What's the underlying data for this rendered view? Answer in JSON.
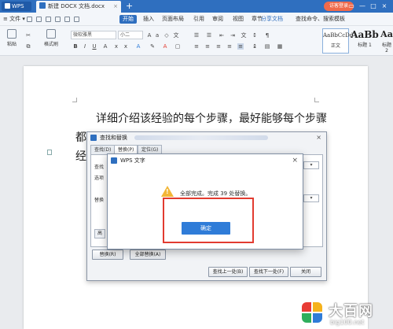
{
  "titlebar": {
    "app_button": "WPS",
    "doc_tab": "新建 DOCX 文档.docx",
    "tab_close": "×",
    "new_tab": "+",
    "login": "访客登录",
    "controls": [
      "▭",
      "—",
      "□",
      "×"
    ]
  },
  "menubar": {
    "file": "≡ 文件 ▾",
    "items": [
      "开始",
      "插入",
      "页面布局",
      "引用",
      "审阅",
      "视图",
      "章节"
    ],
    "share": "分享文档",
    "search": "查找命令、搜索模板"
  },
  "ribbon": {
    "paste": "粘贴",
    "format_painter": "格式刷",
    "font_name": "微软雅黑",
    "font_size": "小二",
    "styles": [
      {
        "sample": "AaBbCcDd",
        "name": "正文"
      },
      {
        "sample": "AaBb",
        "name": "标题 1"
      },
      {
        "sample": "Aa",
        "name": "标题 2"
      }
    ]
  },
  "document": {
    "line1": "详细介绍该经验的每个步骤，最好能够每个步骤",
    "line2": "都",
    "line3": "经"
  },
  "find_replace": {
    "title": "查找和替换",
    "tabs": [
      "查找(D)",
      "替换(P)",
      "定位(G)"
    ],
    "find_label": "查找",
    "options_label": "选项",
    "replace_label": "替换",
    "advanced_short": "高",
    "replace_btn": "替换(R)",
    "replace_all_btn": "全部替换(A)",
    "find_prev_btn": "查找上一处(B)",
    "find_next_btn": "查找下一处(F)",
    "close_btn": "关闭"
  },
  "message": {
    "title": "WPS 文字",
    "text": "全部完成。完成 39 处替换。",
    "ok": "确定"
  },
  "watermark": {
    "title": "大百网",
    "sub": "big100.net"
  }
}
